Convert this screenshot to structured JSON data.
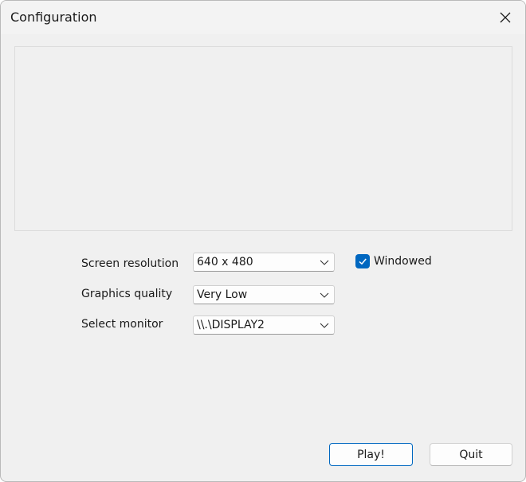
{
  "window": {
    "title": "Configuration",
    "close_icon": "close-icon"
  },
  "form": {
    "resolution": {
      "label": "Screen resolution",
      "value": "640 x 480"
    },
    "quality": {
      "label": "Graphics quality",
      "value": "Very Low"
    },
    "monitor": {
      "label": "Select monitor",
      "value": "\\\\.\\DISPLAY2"
    },
    "windowed": {
      "label": "Windowed",
      "checked": true
    }
  },
  "buttons": {
    "play_label": "Play!",
    "quit_label": "Quit"
  },
  "colors": {
    "accent": "#0067c0",
    "window_bg": "#f0f0f0"
  }
}
